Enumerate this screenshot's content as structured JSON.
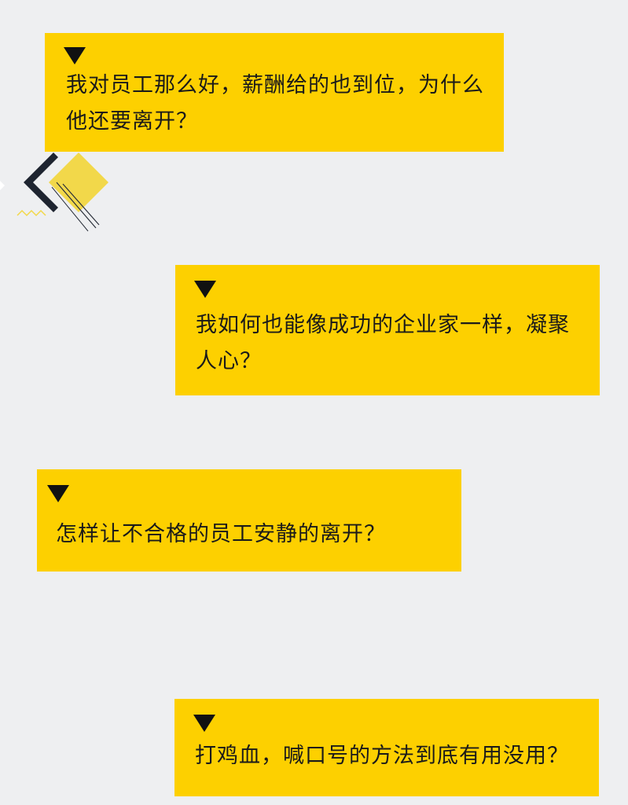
{
  "questions": [
    {
      "text": "我对员工那么好，薪酬给的也到位，为什么\n他还要离开？"
    },
    {
      "text": "我如何也能像成功的企业家一样，凝聚\n人心？"
    },
    {
      "text": "怎样让不合格的员工安静的离开？"
    },
    {
      "text": "打鸡血，喊口号的方法到底有用没用？"
    }
  ],
  "colors": {
    "background": "#eeeff1",
    "card": "#fdd000",
    "marker": "#111111",
    "accent": "#f2d84a"
  }
}
